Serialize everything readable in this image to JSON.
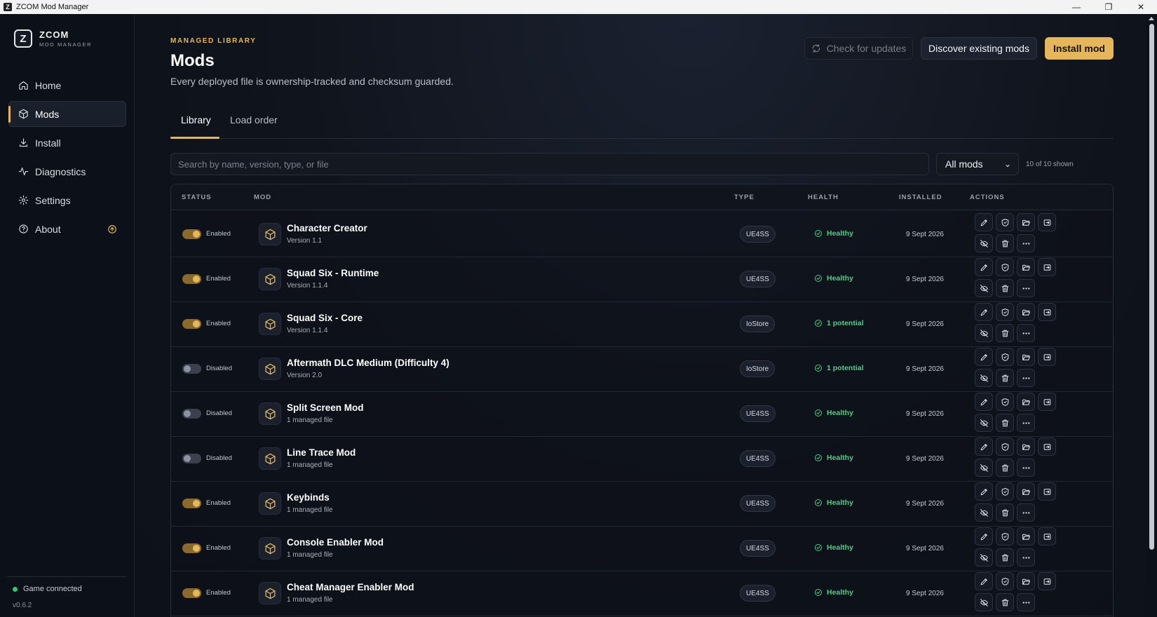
{
  "window": {
    "title": "ZCOM Mod Manager",
    "icon_letter": "Z",
    "controls": [
      "minimize-icon",
      "maximize-icon",
      "close-icon"
    ]
  },
  "brand": {
    "logo_letter": "Z",
    "name": "ZCOM",
    "subtitle": "MOD MANAGER"
  },
  "sidebar": {
    "items": [
      {
        "label": "Home",
        "icon": "home-icon",
        "active": false
      },
      {
        "label": "Mods",
        "icon": "box-icon",
        "active": true
      },
      {
        "label": "Install",
        "icon": "download-icon",
        "active": false
      },
      {
        "label": "Diagnostics",
        "icon": "pulse-icon",
        "active": false
      },
      {
        "label": "Settings",
        "icon": "gear-icon",
        "active": false
      },
      {
        "label": "About",
        "icon": "help-circle-icon",
        "active": false,
        "badge": "update-arrow-icon"
      }
    ],
    "connection": "Game connected",
    "version": "v0.6.2"
  },
  "header": {
    "eyebrow": "MANAGED LIBRARY",
    "title": "Mods",
    "subtitle": "Every deployed file is ownership-tracked and checksum guarded.",
    "buttons": {
      "check_updates": "Check for updates",
      "discover": "Discover existing mods",
      "install": "Install mod"
    }
  },
  "tabs": [
    {
      "label": "Library",
      "active": true
    },
    {
      "label": "Load order",
      "active": false
    }
  ],
  "filter": {
    "search_placeholder": "Search by name, version, type, or file",
    "select_value": "All mods",
    "shown": "10 of 10 shown"
  },
  "table": {
    "columns": [
      "STATUS",
      "MOD",
      "TYPE",
      "HEALTH",
      "INSTALLED",
      "ACTIONS"
    ],
    "rows": [
      {
        "enabled": true,
        "status": "Enabled",
        "name": "Character Creator",
        "sub": "Version 1.1",
        "type": "UE4SS",
        "health": "Healthy",
        "installed": "9 Sept 2026"
      },
      {
        "enabled": true,
        "status": "Enabled",
        "name": "Squad Six - Runtime",
        "sub": "Version 1.1.4",
        "type": "UE4SS",
        "health": "Healthy",
        "installed": "9 Sept 2026"
      },
      {
        "enabled": true,
        "status": "Enabled",
        "name": "Squad Six - Core",
        "sub": "Version 1.1.4",
        "type": "IoStore",
        "health": "1 potential",
        "installed": "9 Sept 2026"
      },
      {
        "enabled": false,
        "status": "Disabled",
        "name": "Aftermath DLC Medium (Difficulty 4)",
        "sub": "Version 2.0",
        "type": "IoStore",
        "health": "1 potential",
        "installed": "9 Sept 2026"
      },
      {
        "enabled": false,
        "status": "Disabled",
        "name": "Split Screen Mod",
        "sub": "1 managed file",
        "type": "UE4SS",
        "health": "Healthy",
        "installed": "9 Sept 2026"
      },
      {
        "enabled": false,
        "status": "Disabled",
        "name": "Line Trace Mod",
        "sub": "1 managed file",
        "type": "UE4SS",
        "health": "Healthy",
        "installed": "9 Sept 2026"
      },
      {
        "enabled": true,
        "status": "Enabled",
        "name": "Keybinds",
        "sub": "1 managed file",
        "type": "UE4SS",
        "health": "Healthy",
        "installed": "9 Sept 2026"
      },
      {
        "enabled": true,
        "status": "Enabled",
        "name": "Console Enabler Mod",
        "sub": "1 managed file",
        "type": "UE4SS",
        "health": "Healthy",
        "installed": "9 Sept 2026"
      },
      {
        "enabled": true,
        "status": "Enabled",
        "name": "Cheat Manager Enabler Mod",
        "sub": "1 managed file",
        "type": "UE4SS",
        "health": "Healthy",
        "installed": "9 Sept 2026"
      }
    ],
    "row_actions": [
      "pencil-icon",
      "shield-icon",
      "folder-open-icon",
      "move-to-icon",
      "eye-off-icon",
      "trash-icon",
      "more-icon"
    ]
  },
  "colors": {
    "accent": "#e6b75a",
    "healthy": "#4fcf86",
    "background": "#0d1119"
  }
}
